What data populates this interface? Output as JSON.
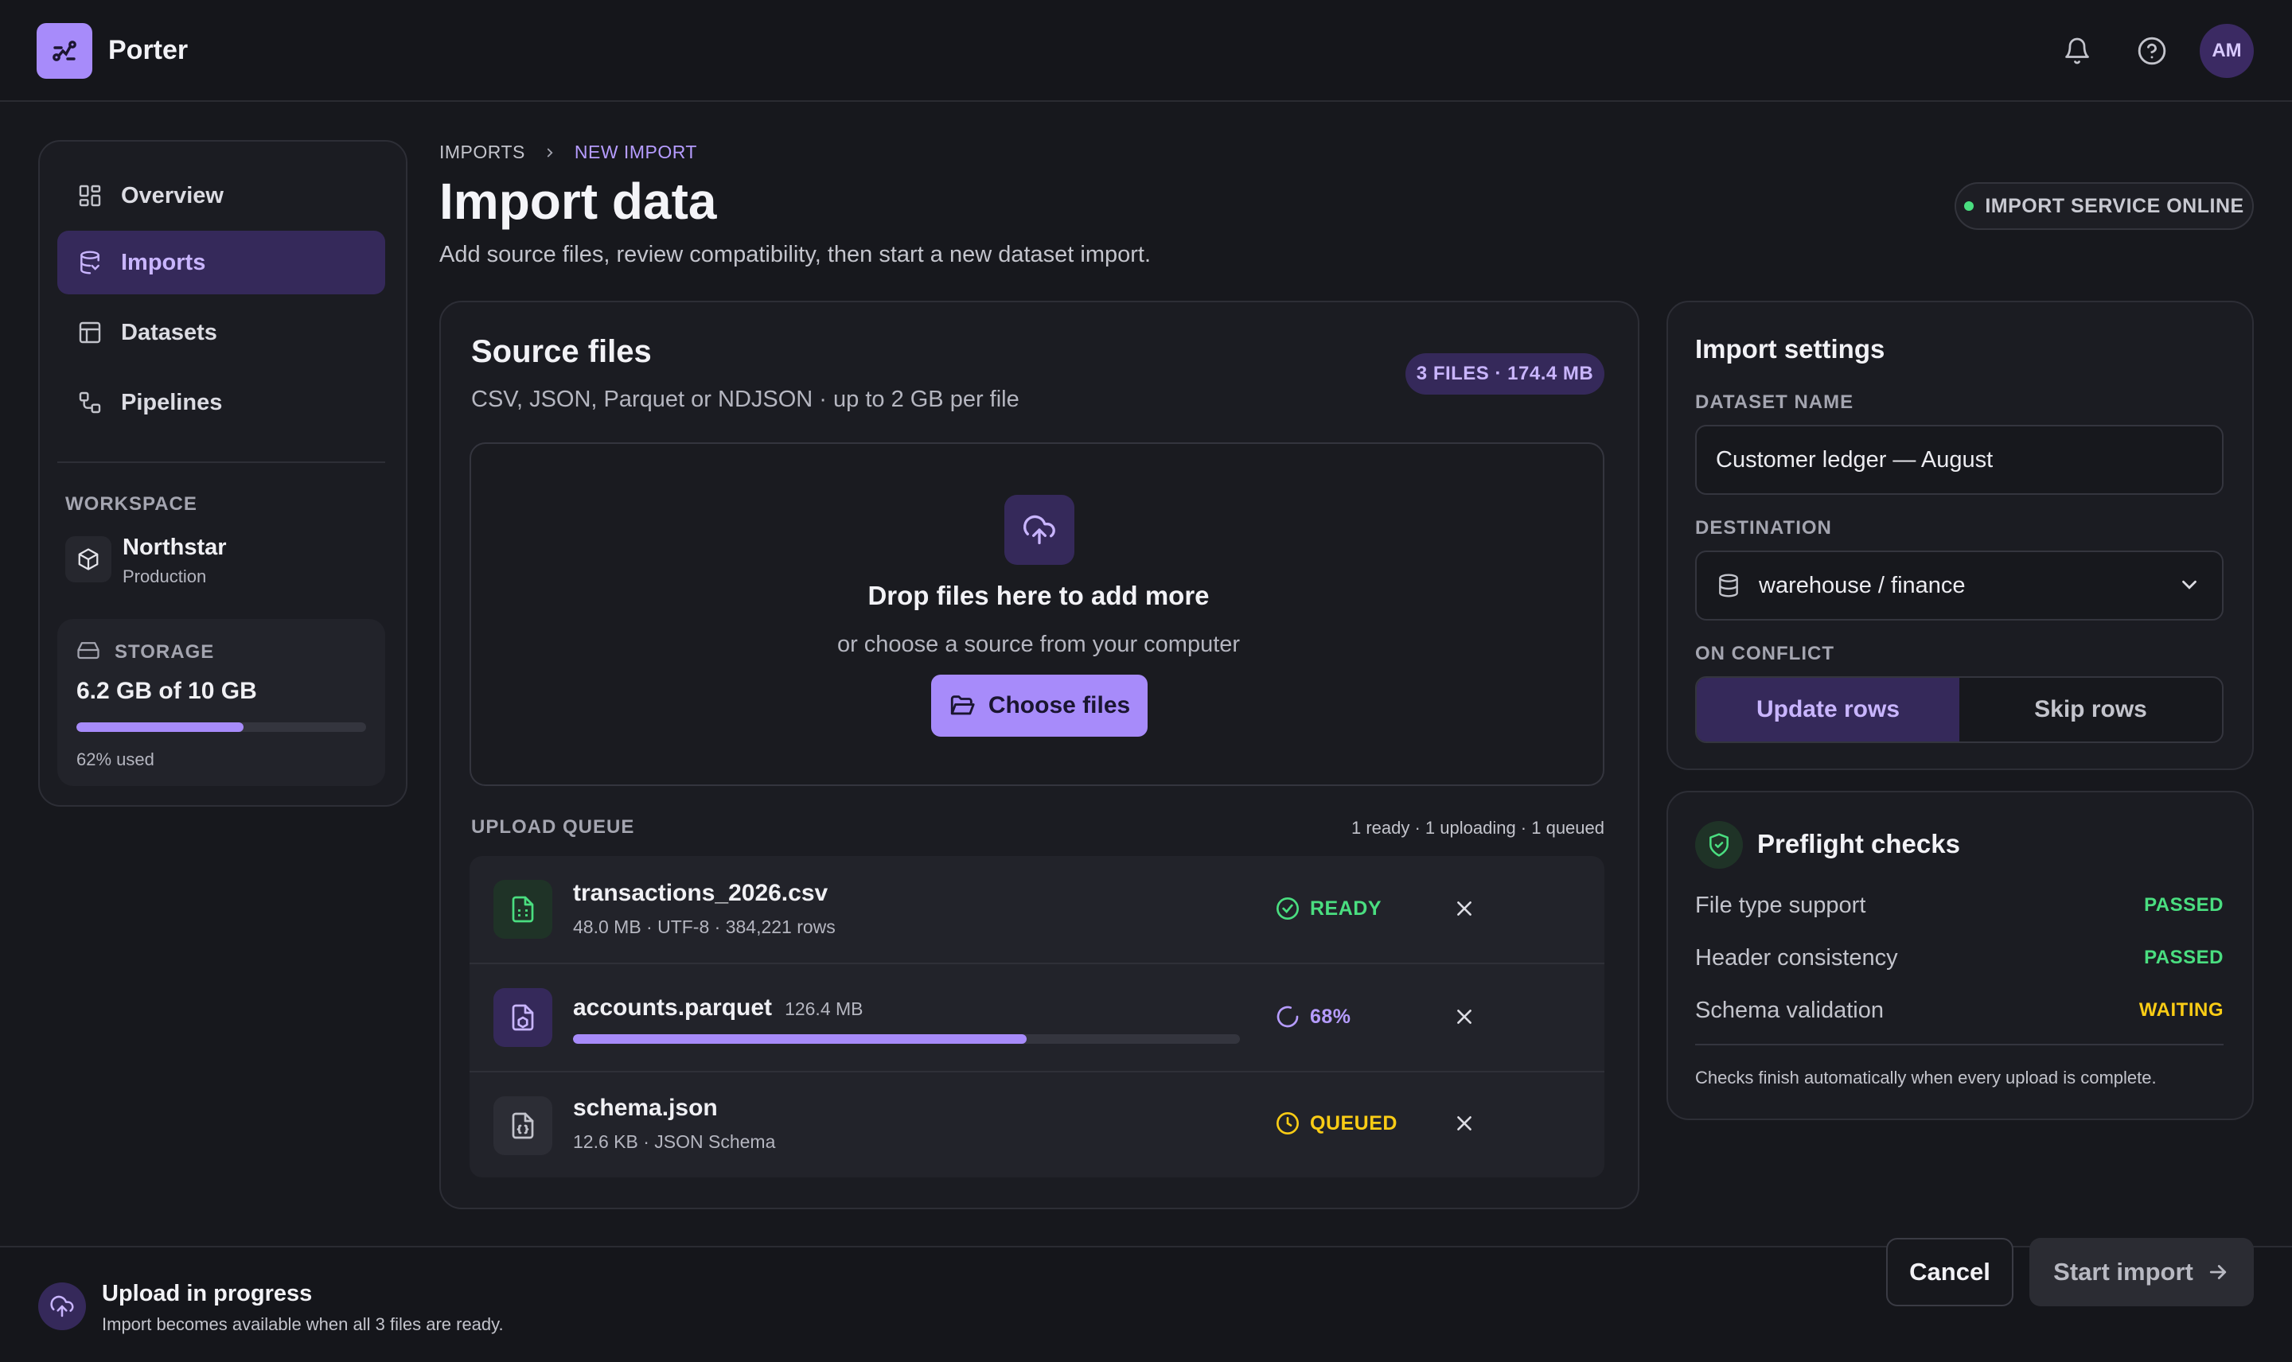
{
  "app": {
    "name": "Porter",
    "avatar_initials": "AM"
  },
  "sidebar": {
    "items": [
      {
        "label": "Overview",
        "icon": "dashboard-icon",
        "active": false
      },
      {
        "label": "Imports",
        "icon": "database-icon",
        "active": true
      },
      {
        "label": "Datasets",
        "icon": "table-icon",
        "active": false
      },
      {
        "label": "Pipelines",
        "icon": "pipeline-icon",
        "active": false
      }
    ],
    "workspace_label": "WORKSPACE",
    "workspace_name": "Northstar",
    "workspace_env": "Production",
    "storage_label": "STORAGE",
    "storage_value": "6.2 GB of 10 GB",
    "storage_fraction": 0.62,
    "storage_used": "62% used"
  },
  "breadcrumb": {
    "parent": "IMPORTS",
    "current": "NEW IMPORT"
  },
  "header": {
    "title": "Import data",
    "subtitle": "Add source files, review compatibility, then start a new dataset import.",
    "service_status": "IMPORT SERVICE ONLINE"
  },
  "source": {
    "title": "Source files",
    "subtitle": "CSV, JSON, Parquet or NDJSON · up to 2 GB per file",
    "badge": "3 FILES · 174.4 MB",
    "drop_title": "Drop files here to add more",
    "drop_sub": "or choose a source from your computer",
    "choose_label": "Choose files",
    "queue_label": "UPLOAD QUEUE",
    "queue_summary": "1 ready · 1 uploading · 1 queued",
    "files": [
      {
        "name": "transactions_2026.csv",
        "meta": "48.0 MB · UTF-8 · 384,221 rows",
        "status": "READY",
        "icon": "csv-file-icon"
      },
      {
        "name": "accounts.parquet",
        "meta": "126.4 MB",
        "status": "68%",
        "progress": 0.68,
        "icon": "parquet-file-icon"
      },
      {
        "name": "schema.json",
        "meta": "12.6 KB · JSON Schema",
        "status": "QUEUED",
        "icon": "json-file-icon"
      }
    ]
  },
  "settings": {
    "title": "Import settings",
    "dataset_label": "DATASET NAME",
    "dataset_value": "Customer ledger — August",
    "destination_label": "DESTINATION",
    "destination_value": "warehouse / finance",
    "conflict_label": "ON CONFLICT",
    "conflict_options": [
      "Update rows",
      "Skip rows"
    ],
    "conflict_selected": "Update rows"
  },
  "preflight": {
    "title": "Preflight checks",
    "checks": [
      {
        "name": "File type support",
        "status": "PASSED"
      },
      {
        "name": "Header consistency",
        "status": "PASSED"
      },
      {
        "name": "Schema validation",
        "status": "WAITING"
      }
    ],
    "note": "Checks finish automatically when every upload is complete."
  },
  "footer": {
    "title": "Upload in progress",
    "subtitle": "Import becomes available when all 3 files are ready.",
    "cancel_label": "Cancel",
    "start_label": "Start import"
  },
  "colors": {
    "accent": "#a78bfa",
    "success": "#4ade80",
    "warning": "#facc15",
    "background": "#17181d"
  }
}
